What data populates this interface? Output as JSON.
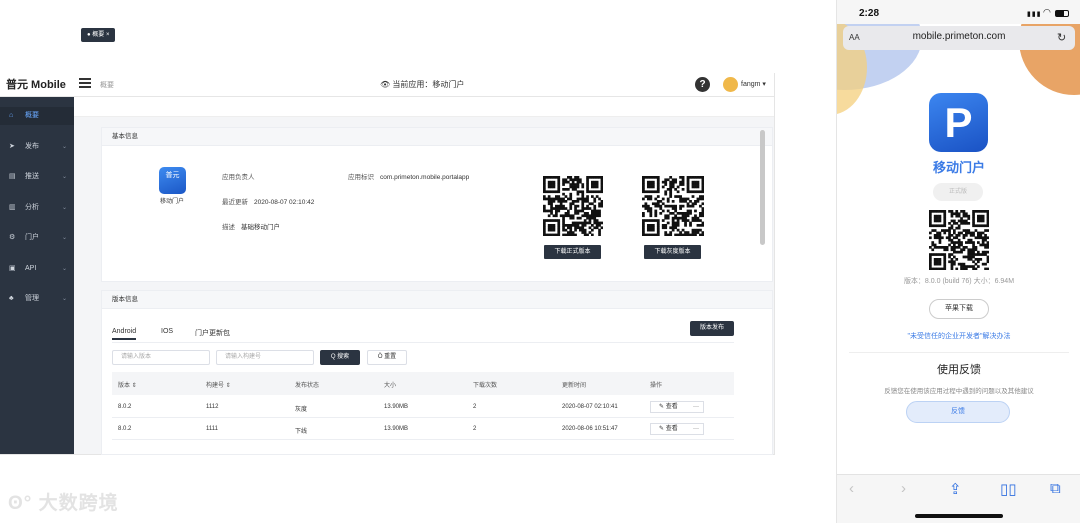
{
  "desktop": {
    "brand": "普元 Mobile",
    "breadcrumb": "概要",
    "current_app": "当前应用：移动门户",
    "username": "fangm",
    "sidebar": [
      {
        "label": "概要",
        "icon": "home-icon",
        "glyph": "⌂"
      },
      {
        "label": "发布",
        "icon": "send-icon",
        "glyph": "➤"
      },
      {
        "label": "推送",
        "icon": "inbox-icon",
        "glyph": "▤"
      },
      {
        "label": "分析",
        "icon": "chart-icon",
        "glyph": "▥"
      },
      {
        "label": "门户",
        "icon": "gear-icon",
        "glyph": "⚙"
      },
      {
        "label": "API",
        "icon": "api-icon",
        "glyph": "▣"
      },
      {
        "label": "管理",
        "icon": "org-icon",
        "glyph": "♣"
      }
    ],
    "tab_chip": "● 概要 ×",
    "basic_info": {
      "title": "基本信息",
      "app_icon_text": "普元",
      "app_icon_label": "移动门户",
      "owner_label": "应用负责人",
      "owner_value": "",
      "id_label": "应用标识",
      "id_value": "com.primeton.mobile.portalapp",
      "updated_label": "最近更新",
      "updated_value": "2020-08-07 02:10:42",
      "desc_label": "描述",
      "desc_value": "基础移动门户",
      "download_official": "下载正式版本",
      "download_grey": "下载灰度版本"
    },
    "version_info": {
      "title": "版本信息",
      "tabs": [
        "Android",
        "IOS",
        "门户更新包"
      ],
      "release_button": "版本发布",
      "version_placeholder": "请输入版本",
      "build_placeholder": "请输入构建号",
      "search_button": "Q 搜索",
      "reset_button": "Ö 重置",
      "columns": [
        "版本 ⇕",
        "构建号 ⇕",
        "发布状态",
        "大小",
        "下载次数",
        "更新时间",
        "操作"
      ],
      "rows": [
        {
          "version": "8.0.2",
          "build": "1112",
          "status": "灰度",
          "size": "13.90MB",
          "downloads": "2",
          "updated": "2020-08-07 02:10:41",
          "action": "✎ 查看"
        },
        {
          "version": "8.0.2",
          "build": "1111",
          "status": "下线",
          "size": "13.90MB",
          "downloads": "2",
          "updated": "2020-08-06 10:51:47",
          "action": "✎ 查看"
        }
      ],
      "more_glyph": "···"
    }
  },
  "phone": {
    "time": "2:28",
    "aa": "AA",
    "url": "mobile.primeton.com",
    "app_name": "移动门户",
    "logo_letter": "P",
    "badge": "正式版",
    "version_line": " 版本：8.0.0 (build 76)  大小：6.94M",
    "apple_download": "苹果下载",
    "trust_link": "\"未受信任的企业开发者\"解决办法",
    "feedback_title": "使用反馈",
    "feedback_desc": "反馈您在使用该应用过程中遇到的问题以及其他建议",
    "feedback_button": "反馈"
  },
  "watermark": "大数跨境",
  "colors": {
    "sidebar": "#2b3441",
    "accent": "#3b7be6",
    "dark_button": "#2b3441"
  }
}
